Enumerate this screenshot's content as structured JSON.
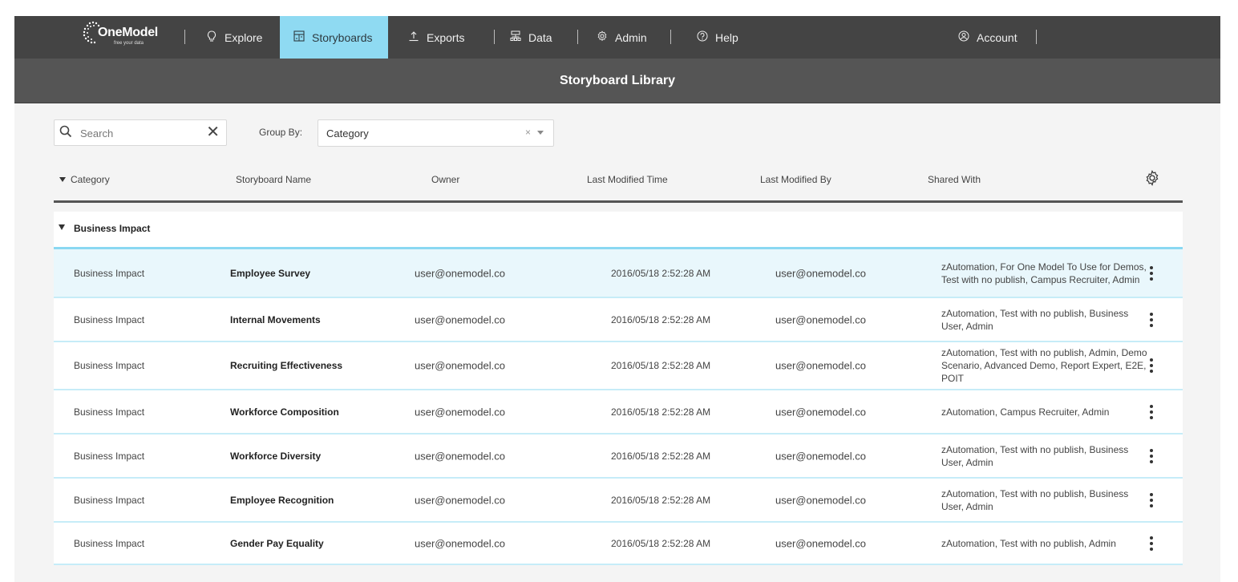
{
  "brand": {
    "name": "OneModel",
    "tagline": "free your data"
  },
  "nav": {
    "items": [
      {
        "label": "Explore",
        "icon": "lightbulb-icon",
        "active": false
      },
      {
        "label": "Storyboards",
        "icon": "storyboard-icon",
        "active": true
      },
      {
        "label": "Exports",
        "icon": "upload-icon",
        "active": false
      },
      {
        "label": "Data",
        "icon": "hierarchy-icon",
        "active": false
      },
      {
        "label": "Admin",
        "icon": "gear-icon",
        "active": false
      },
      {
        "label": "Help",
        "icon": "help-circle-icon",
        "active": false
      }
    ],
    "account": {
      "label": "Account",
      "icon": "user-circle-icon"
    }
  },
  "page": {
    "title": "Storyboard Library"
  },
  "toolbar": {
    "search": {
      "placeholder": "Search",
      "value": ""
    },
    "group_by": {
      "label": "Group By:",
      "value": "Category"
    }
  },
  "table": {
    "columns": [
      "Category",
      "Storyboard Name",
      "Owner",
      "Last Modified Time",
      "Last Modified By",
      "Shared With"
    ],
    "groups": [
      {
        "label": "Business Impact",
        "rows": [
          {
            "category": "Business Impact",
            "name": "Employee Survey",
            "owner": "user@onemodel.co",
            "modified_time": "2016/05/18 2:52:28 AM",
            "modified_by": "user@onemodel.co",
            "shared_with": "zAutomation, For One Model To Use for Demos, Test with no publish, Campus Recruiter, Admin",
            "selected": true
          },
          {
            "category": "Business Impact",
            "name": "Internal Movements",
            "owner": "user@onemodel.co",
            "modified_time": "2016/05/18 2:52:28 AM",
            "modified_by": "user@onemodel.co",
            "shared_with": "zAutomation, Test with no publish, Business User, Admin"
          },
          {
            "category": "Business Impact",
            "name": "Recruiting Effectiveness",
            "owner": "user@onemodel.co",
            "modified_time": "2016/05/18 2:52:28 AM",
            "modified_by": "user@onemodel.co",
            "shared_with": "zAutomation, Test with no publish, Admin, Demo Scenario, Advanced Demo, Report Expert, E2E, POIT"
          },
          {
            "category": "Business Impact",
            "name": "Workforce Composition",
            "owner": "user@onemodel.co",
            "modified_time": "2016/05/18 2:52:28 AM",
            "modified_by": "user@onemodel.co",
            "shared_with": "zAutomation, Campus Recruiter, Admin"
          },
          {
            "category": "Business Impact",
            "name": "Workforce Diversity",
            "owner": "user@onemodel.co",
            "modified_time": "2016/05/18 2:52:28 AM",
            "modified_by": "user@onemodel.co",
            "shared_with": "zAutomation, Test with no publish, Business User, Admin"
          },
          {
            "category": "Business Impact",
            "name": "Employee Recognition",
            "owner": "user@onemodel.co",
            "modified_time": "2016/05/18 2:52:28 AM",
            "modified_by": "user@onemodel.co",
            "shared_with": "zAutomation, Test with no publish, Business User, Admin"
          },
          {
            "category": "Business Impact",
            "name": "Gender Pay Equality",
            "owner": "user@onemodel.co",
            "modified_time": "2016/05/18 2:52:28 AM",
            "modified_by": "user@onemodel.co",
            "shared_with": "zAutomation, Test with no publish, Admin"
          }
        ]
      }
    ]
  },
  "colors": {
    "nav_bg": "#444444",
    "title_bg": "#555555",
    "active_tab": "#8fdaf2",
    "row_selected": "#e9f7fc",
    "row_border": "#c6ecf8"
  }
}
